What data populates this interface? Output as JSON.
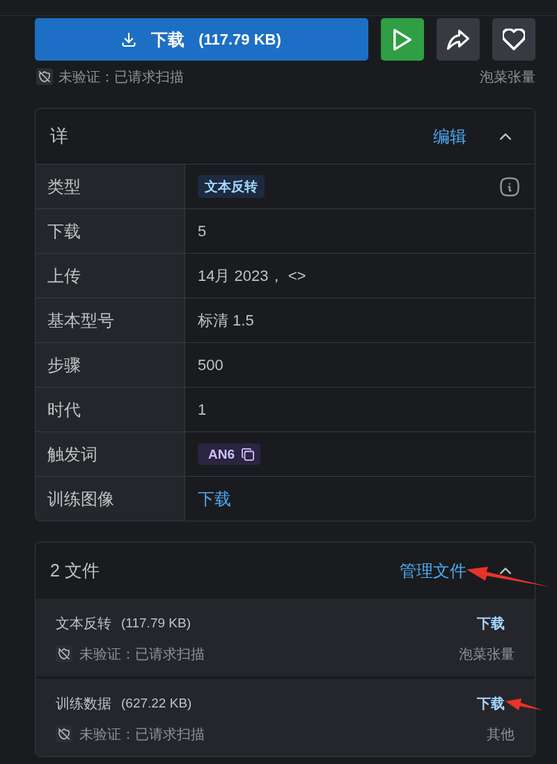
{
  "actions": {
    "download": {
      "label": "下载",
      "size": "(117.79 KB)"
    }
  },
  "scan_status": {
    "text": "未验证：已请求扫描",
    "author": "泡菜张量"
  },
  "details": {
    "title": "详",
    "edit": "编辑",
    "expanded": true,
    "rows": [
      {
        "label": "类型",
        "kind": "badge",
        "value": "文本反转"
      },
      {
        "label": "下载",
        "kind": "text",
        "value": "5"
      },
      {
        "label": "上传",
        "kind": "text",
        "value": "14月 2023， <>"
      },
      {
        "label": "基本型号",
        "kind": "text",
        "value": "标清 1.5"
      },
      {
        "label": "步骤",
        "kind": "text",
        "value": "500"
      },
      {
        "label": "时代",
        "kind": "text",
        "value": "1"
      },
      {
        "label": "触发词",
        "kind": "copy_tag",
        "value": "AN6"
      },
      {
        "label": "训练图像",
        "kind": "link",
        "value": "下载"
      }
    ]
  },
  "files": {
    "title": "2 文件",
    "manage": "管理文件",
    "expanded": true,
    "items": [
      {
        "name": "文本反转",
        "size": "(117.79 KB)",
        "download": "下载",
        "status": "未验证：已请求扫描",
        "source": "泡菜张量"
      },
      {
        "name": "训练数据",
        "size": "(627.22 KB)",
        "download": "下载",
        "status": "未验证：已请求扫描",
        "source": "其他"
      }
    ]
  }
}
